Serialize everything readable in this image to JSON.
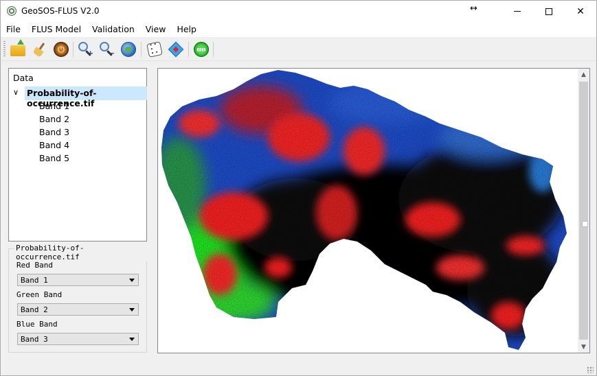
{
  "window": {
    "title": "GeoSOS-FLUS V2.0",
    "controls": {
      "minimize": "—",
      "maximize": "☐",
      "close": "✕"
    }
  },
  "menu": [
    "File",
    "FLUS Model",
    "Validation",
    "View",
    "Help"
  ],
  "toolbar": {
    "buttons": [
      {
        "name": "open-file",
        "icon": "folder-open-icon"
      },
      {
        "name": "clear",
        "icon": "broom-icon"
      },
      {
        "name": "exit",
        "icon": "power-icon"
      },
      {
        "name": "zoom-in",
        "icon": "zoom-in-icon"
      },
      {
        "name": "zoom-out",
        "icon": "zoom-out-icon"
      },
      {
        "name": "full-extent",
        "icon": "globe-icon"
      },
      {
        "name": "random-sampling",
        "icon": "dice-icon"
      },
      {
        "name": "layer-tool",
        "icon": "diamond-layer-icon"
      },
      {
        "name": "run-model",
        "icon": "run-icon"
      }
    ]
  },
  "data_tree": {
    "header": "Data",
    "root": "Probability-of-occurrence.tif",
    "children": [
      "Band 1",
      "Band 2",
      "Band 3",
      "Band 4",
      "Band 5"
    ]
  },
  "band_settings": {
    "group_title": "Probability-of-occurrence.tif",
    "red_label": "Red  Band",
    "red_value": "Band 1",
    "green_label": "Green Band",
    "green_value": "Band 2",
    "blue_label": "Blue  Band",
    "blue_value": "Band 3"
  },
  "colors": {
    "selection": "#cce8ff",
    "map_red": "#ff2020",
    "map_green": "#22ee22",
    "map_blue": "#2050e0",
    "map_black": "#050505"
  }
}
